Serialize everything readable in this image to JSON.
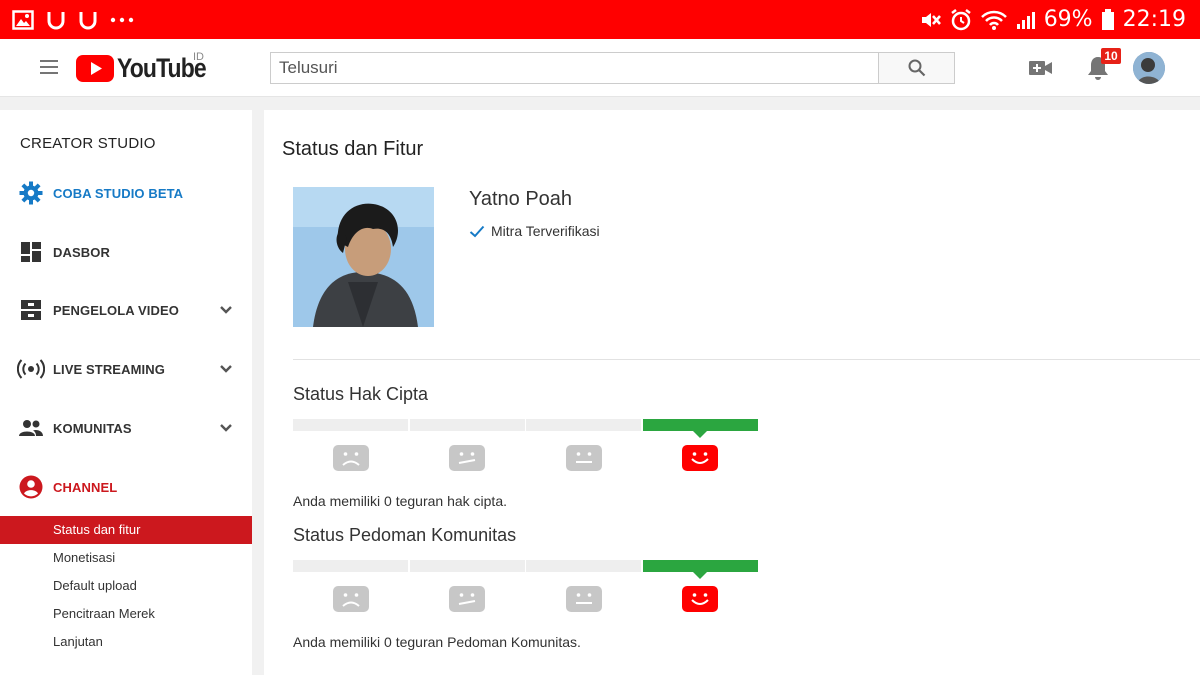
{
  "status_bar": {
    "left_icons": [
      "image-icon",
      "u-notification-icon",
      "u-notification-icon",
      "more-dots-icon"
    ],
    "battery": "69%",
    "time": "22:19",
    "right_icons": [
      "mute-icon",
      "alarm-icon",
      "wifi-icon",
      "signal-icon",
      "battery-icon"
    ],
    "color": "#ff0000"
  },
  "header": {
    "logo_text": "YouTube",
    "region": "ID",
    "search_placeholder": "Telusuri",
    "notification_count": "10",
    "brand_color": "#ff0000"
  },
  "sidebar": {
    "title": "CREATOR STUDIO",
    "items": [
      {
        "label": "COBA STUDIO BETA",
        "icon": "gear-icon"
      },
      {
        "label": "DASBOR",
        "icon": "dashboard-icon"
      },
      {
        "label": "PENGELOLA VIDEO",
        "icon": "video-manager-icon"
      },
      {
        "label": "LIVE STREAMING",
        "icon": "live-icon"
      },
      {
        "label": "KOMUNITAS",
        "icon": "community-icon"
      },
      {
        "label": "CHANNEL",
        "icon": "account-circle-icon"
      }
    ],
    "channel_sub_items": [
      {
        "label": "Status dan fitur",
        "active": true
      },
      {
        "label": "Monetisasi"
      },
      {
        "label": "Default upload"
      },
      {
        "label": "Pencitraan Merek"
      },
      {
        "label": "Lanjutan"
      }
    ],
    "active_color": "#cc181e"
  },
  "main": {
    "title": "Status dan Fitur",
    "channel_name": "Yatno Poah",
    "verified_label": "Mitra Terverifikasi",
    "copyright": {
      "title": "Status Hak Cipta",
      "level": 4,
      "note": "Anda memiliki 0 teguran hak cipta."
    },
    "community": {
      "title": "Status Pedoman Komunitas",
      "level": 4,
      "note": "Anda memiliki 0 teguran Pedoman Komunitas."
    },
    "good_color": "#2ba640"
  }
}
